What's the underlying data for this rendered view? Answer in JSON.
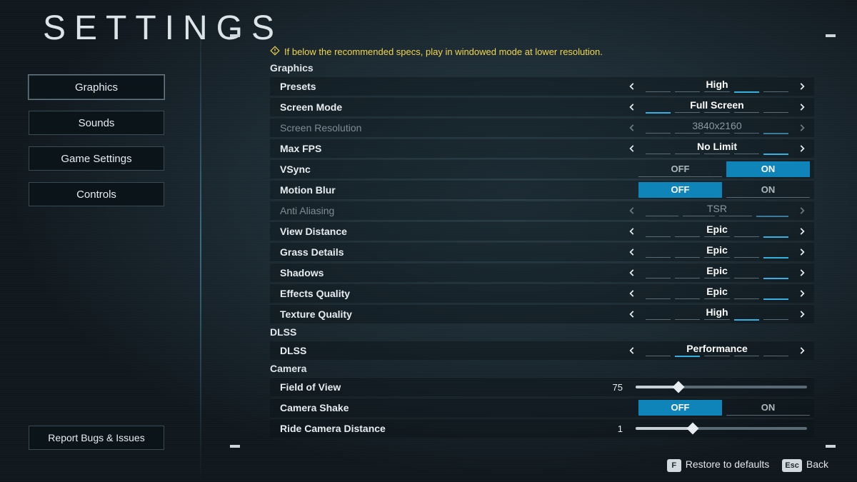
{
  "title": "SETTINGS",
  "hint": "If below the recommended specs, play in windowed mode at lower resolution.",
  "sidebar": {
    "items": [
      {
        "label": "Graphics",
        "active": true
      },
      {
        "label": "Sounds",
        "active": false
      },
      {
        "label": "Game Settings",
        "active": false
      },
      {
        "label": "Controls",
        "active": false
      }
    ],
    "report": "Report Bugs & Issues"
  },
  "toggles": {
    "off": "OFF",
    "on": "ON"
  },
  "sections": [
    {
      "name": "Graphics",
      "rows": [
        {
          "label": "Presets",
          "type": "sel",
          "value": "High",
          "ticks": 5,
          "activeTick": 3,
          "disabled": false
        },
        {
          "label": "Screen Mode",
          "type": "sel",
          "value": "Full Screen",
          "ticks": 5,
          "activeTick": 0,
          "disabled": false
        },
        {
          "label": "Screen Resolution",
          "type": "sel",
          "value": "3840x2160",
          "ticks": 5,
          "activeTick": 4,
          "disabled": true
        },
        {
          "label": "Max FPS",
          "type": "sel",
          "value": "No Limit",
          "ticks": 5,
          "activeTick": 4,
          "disabled": false
        },
        {
          "label": "VSync",
          "type": "toggle",
          "value": "ON",
          "disabled": false
        },
        {
          "label": "Motion Blur",
          "type": "toggle",
          "value": "OFF",
          "disabled": false
        },
        {
          "label": "Anti Aliasing",
          "type": "sel",
          "value": "TSR",
          "ticks": 4,
          "activeTick": 3,
          "disabled": true
        },
        {
          "label": "View Distance",
          "type": "sel",
          "value": "Epic",
          "ticks": 5,
          "activeTick": 4,
          "disabled": false
        },
        {
          "label": "Grass Details",
          "type": "sel",
          "value": "Epic",
          "ticks": 5,
          "activeTick": 4,
          "disabled": false
        },
        {
          "label": "Shadows",
          "type": "sel",
          "value": "Epic",
          "ticks": 5,
          "activeTick": 4,
          "disabled": false
        },
        {
          "label": "Effects Quality",
          "type": "sel",
          "value": "Epic",
          "ticks": 5,
          "activeTick": 4,
          "disabled": false
        },
        {
          "label": "Texture Quality",
          "type": "sel",
          "value": "High",
          "ticks": 5,
          "activeTick": 3,
          "disabled": false
        }
      ]
    },
    {
      "name": "DLSS",
      "rows": [
        {
          "label": "DLSS",
          "type": "sel",
          "value": "Performance",
          "ticks": 5,
          "activeTick": 1,
          "disabled": false
        }
      ]
    },
    {
      "name": "Camera",
      "rows": [
        {
          "label": "Field of View",
          "type": "slider",
          "value": 75,
          "min": 60,
          "max": 120
        },
        {
          "label": "Camera Shake",
          "type": "toggle",
          "value": "OFF"
        },
        {
          "label": "Ride Camera Distance",
          "type": "slider",
          "value": 1,
          "min": 0,
          "max": 3
        }
      ]
    }
  ],
  "footer": {
    "restore_key": "F",
    "restore_label": "Restore to defaults",
    "back_key": "Esc",
    "back_label": "Back"
  }
}
